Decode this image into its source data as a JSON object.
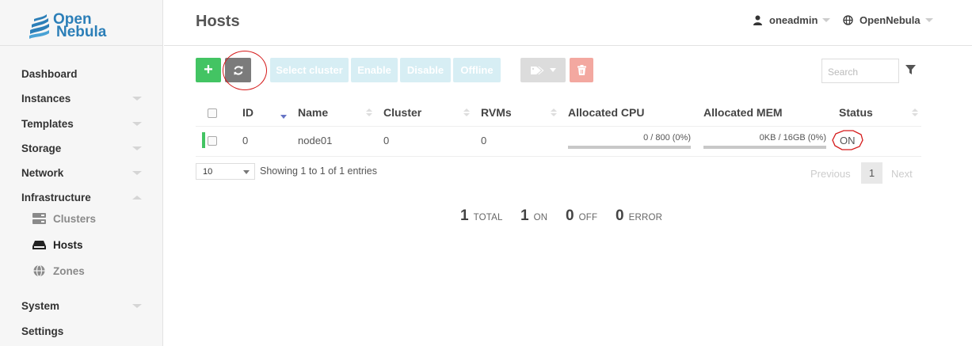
{
  "brand": {
    "line1": "Open",
    "line2": "Nebula",
    "color": "#2c7fb8"
  },
  "sidebar": {
    "items": [
      {
        "label": "Dashboard"
      },
      {
        "label": "Instances"
      },
      {
        "label": "Templates"
      },
      {
        "label": "Storage"
      },
      {
        "label": "Network"
      },
      {
        "label": "Infrastructure"
      },
      {
        "label": "System"
      },
      {
        "label": "Settings"
      }
    ],
    "sub_items": [
      {
        "label": "Clusters",
        "icon": "server-icon"
      },
      {
        "label": "Hosts",
        "icon": "hdd-icon",
        "active": true
      },
      {
        "label": "Zones",
        "icon": "globe-icon"
      }
    ]
  },
  "header": {
    "title": "Hosts",
    "user": "oneadmin",
    "zone": "OpenNebula"
  },
  "toolbar": {
    "add_label": "+",
    "select_cluster_label": "Select cluster",
    "enable_label": "Enable",
    "disable_label": "Disable",
    "offline_label": "Offline",
    "search_placeholder": "Search",
    "colors": {
      "add": "#43c463",
      "refresh": "#7b7b7b",
      "pale": "#d7eef4",
      "delete": "#f3a8a0"
    }
  },
  "table": {
    "columns": [
      "ID",
      "Name",
      "Cluster",
      "RVMs",
      "Allocated CPU",
      "Allocated MEM",
      "Status"
    ],
    "rows": [
      {
        "id": "0",
        "name": "node01",
        "cluster": "0",
        "rvms": "0",
        "cpu": "0 / 800 (0%)",
        "cpu_pct": 0,
        "mem": "0KB / 16GB (0%)",
        "mem_pct": 0,
        "status": "ON",
        "status_color": "#43c463"
      }
    ]
  },
  "pagination": {
    "page_length": "10",
    "info": "Showing 1 to 1 of 1 entries",
    "previous": "Previous",
    "current": "1",
    "next": "Next"
  },
  "summary": [
    {
      "count": "1",
      "label": "TOTAL"
    },
    {
      "count": "1",
      "label": "ON"
    },
    {
      "count": "0",
      "label": "OFF"
    },
    {
      "count": "0",
      "label": "ERROR"
    }
  ]
}
